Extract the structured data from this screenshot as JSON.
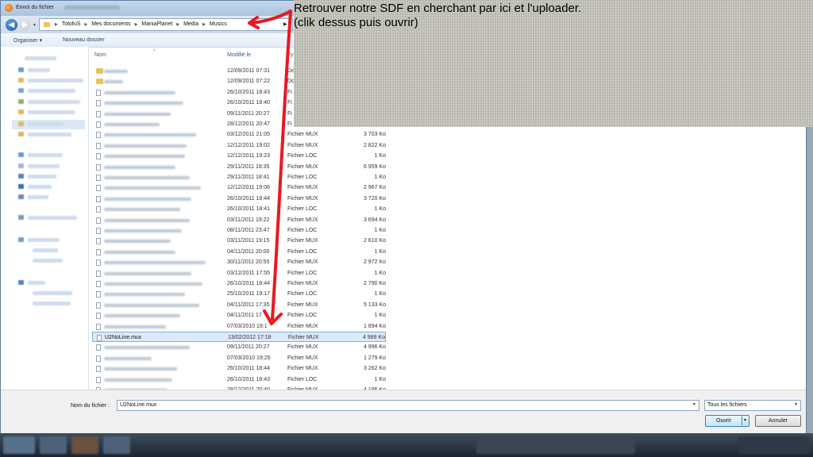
{
  "window": {
    "title": "Envoi du fichier"
  },
  "address_bar": {
    "crumbs": [
      "TotofuS",
      "Mes documents",
      "ManiaPlanet",
      "Media",
      "Musics"
    ]
  },
  "toolbar": {
    "organize_label": "Organiser ▾",
    "new_folder_label": "Nouveau dossier"
  },
  "columns": {
    "name": "Nom",
    "date": "Modifié le",
    "type": "Ty"
  },
  "files": [
    {
      "date": "12/09/2011 07:31",
      "type": "Do",
      "size": "",
      "folder": true
    },
    {
      "date": "12/09/2011 07:22",
      "type": "Do",
      "size": "",
      "folder": true
    },
    {
      "date": "26/10/2011 18:43",
      "type": "Fi",
      "size": ""
    },
    {
      "date": "26/10/2011 18:40",
      "type": "Fi",
      "size": ""
    },
    {
      "date": "09/11/2011 20:27",
      "type": "Fi",
      "size": ""
    },
    {
      "date": "28/12/2011 20:47",
      "type": "Fi",
      "size": ""
    },
    {
      "date": "03/12/2011 21:05",
      "type": "Fichier MUX",
      "size": "3 703 Ko"
    },
    {
      "date": "12/12/2011 19:02",
      "type": "Fichier MUX",
      "size": "2 822 Ko"
    },
    {
      "date": "12/12/2011 19:23",
      "type": "Fichier LOC",
      "size": "1 Ko"
    },
    {
      "date": "29/11/2011 18:35",
      "type": "Fichier MUX",
      "size": "6 959 Ko"
    },
    {
      "date": "29/11/2011 18:41",
      "type": "Fichier LOC",
      "size": "1 Ko"
    },
    {
      "date": "12/12/2011 19:06",
      "type": "Fichier MUX",
      "size": "2 967 Ko"
    },
    {
      "date": "26/10/2011 18:44",
      "type": "Fichier MUX",
      "size": "3 720 Ko"
    },
    {
      "date": "26/10/2011 18:41",
      "type": "Fichier LOC",
      "size": "1 Ko"
    },
    {
      "date": "03/11/2011 19:22",
      "type": "Fichier MUX",
      "size": "3 694 Ko"
    },
    {
      "date": "08/11/2011 23:47",
      "type": "Fichier LOC",
      "size": "1 Ko"
    },
    {
      "date": "03/11/2011 19:15",
      "type": "Fichier MUX",
      "size": "2 610 Ko"
    },
    {
      "date": "04/11/2011 20:00",
      "type": "Fichier LOC",
      "size": "1 Ko"
    },
    {
      "date": "30/11/2011 20:55",
      "type": "Fichier MUX",
      "size": "2 972 Ko"
    },
    {
      "date": "03/12/2011 17:55",
      "type": "Fichier LOC",
      "size": "1 Ko"
    },
    {
      "date": "26/10/2011 18:44",
      "type": "Fichier MUX",
      "size": "2 790 Ko"
    },
    {
      "date": "25/10/2011 19:17",
      "type": "Fichier LOC",
      "size": "1 Ko"
    },
    {
      "date": "04/11/2011 17:35",
      "type": "Fichier MUX",
      "size": "5 133 Ko"
    },
    {
      "date": "04/11/2011 17",
      "type": "Fichier LOC",
      "size": "1 Ko"
    },
    {
      "date": "07/03/2010 19:1",
      "type": "Fichier MUX",
      "size": "1 894 Ko"
    },
    {
      "name": "U2NoLine.mux",
      "date": "13/02/2012 17:18",
      "type": "Fichier MUX",
      "size": "4 989 Ko",
      "selected": true
    },
    {
      "date": "09/11/2011 20:27",
      "type": "Fichier MUX",
      "size": "4 996 Ko"
    },
    {
      "date": "07/03/2010 19:25",
      "type": "Fichier MUX",
      "size": "1 279 Ko"
    },
    {
      "date": "26/10/2011 18:44",
      "type": "Fichier MUX",
      "size": "3 262 Ko"
    },
    {
      "date": "26/10/2011 18:43",
      "type": "Fichier LOC",
      "size": "1 Ko"
    },
    {
      "date": "28/12/2011 20:40",
      "type": "Fichier MUX",
      "size": "4 196 Ko"
    }
  ],
  "bottom": {
    "filename_label": "Nom du fichier :",
    "filename_value": "U2NoLine.mux",
    "filter_value": "Tous les fichiers",
    "open_label": "Ouvrir",
    "cancel_label": "Annuler"
  },
  "annotation": {
    "line1": "Retrouver notre SDF en cherchant par ici et l'uploader.",
    "line2": "(clik dessus puis ouvrir)",
    "arrow_color": "#e8191f"
  },
  "icons": {
    "back": "back-arrow-icon",
    "forward": "forward-arrow-icon",
    "folder": "folder-icon",
    "file": "file-icon",
    "dropdown": "chevron-down-icon"
  }
}
